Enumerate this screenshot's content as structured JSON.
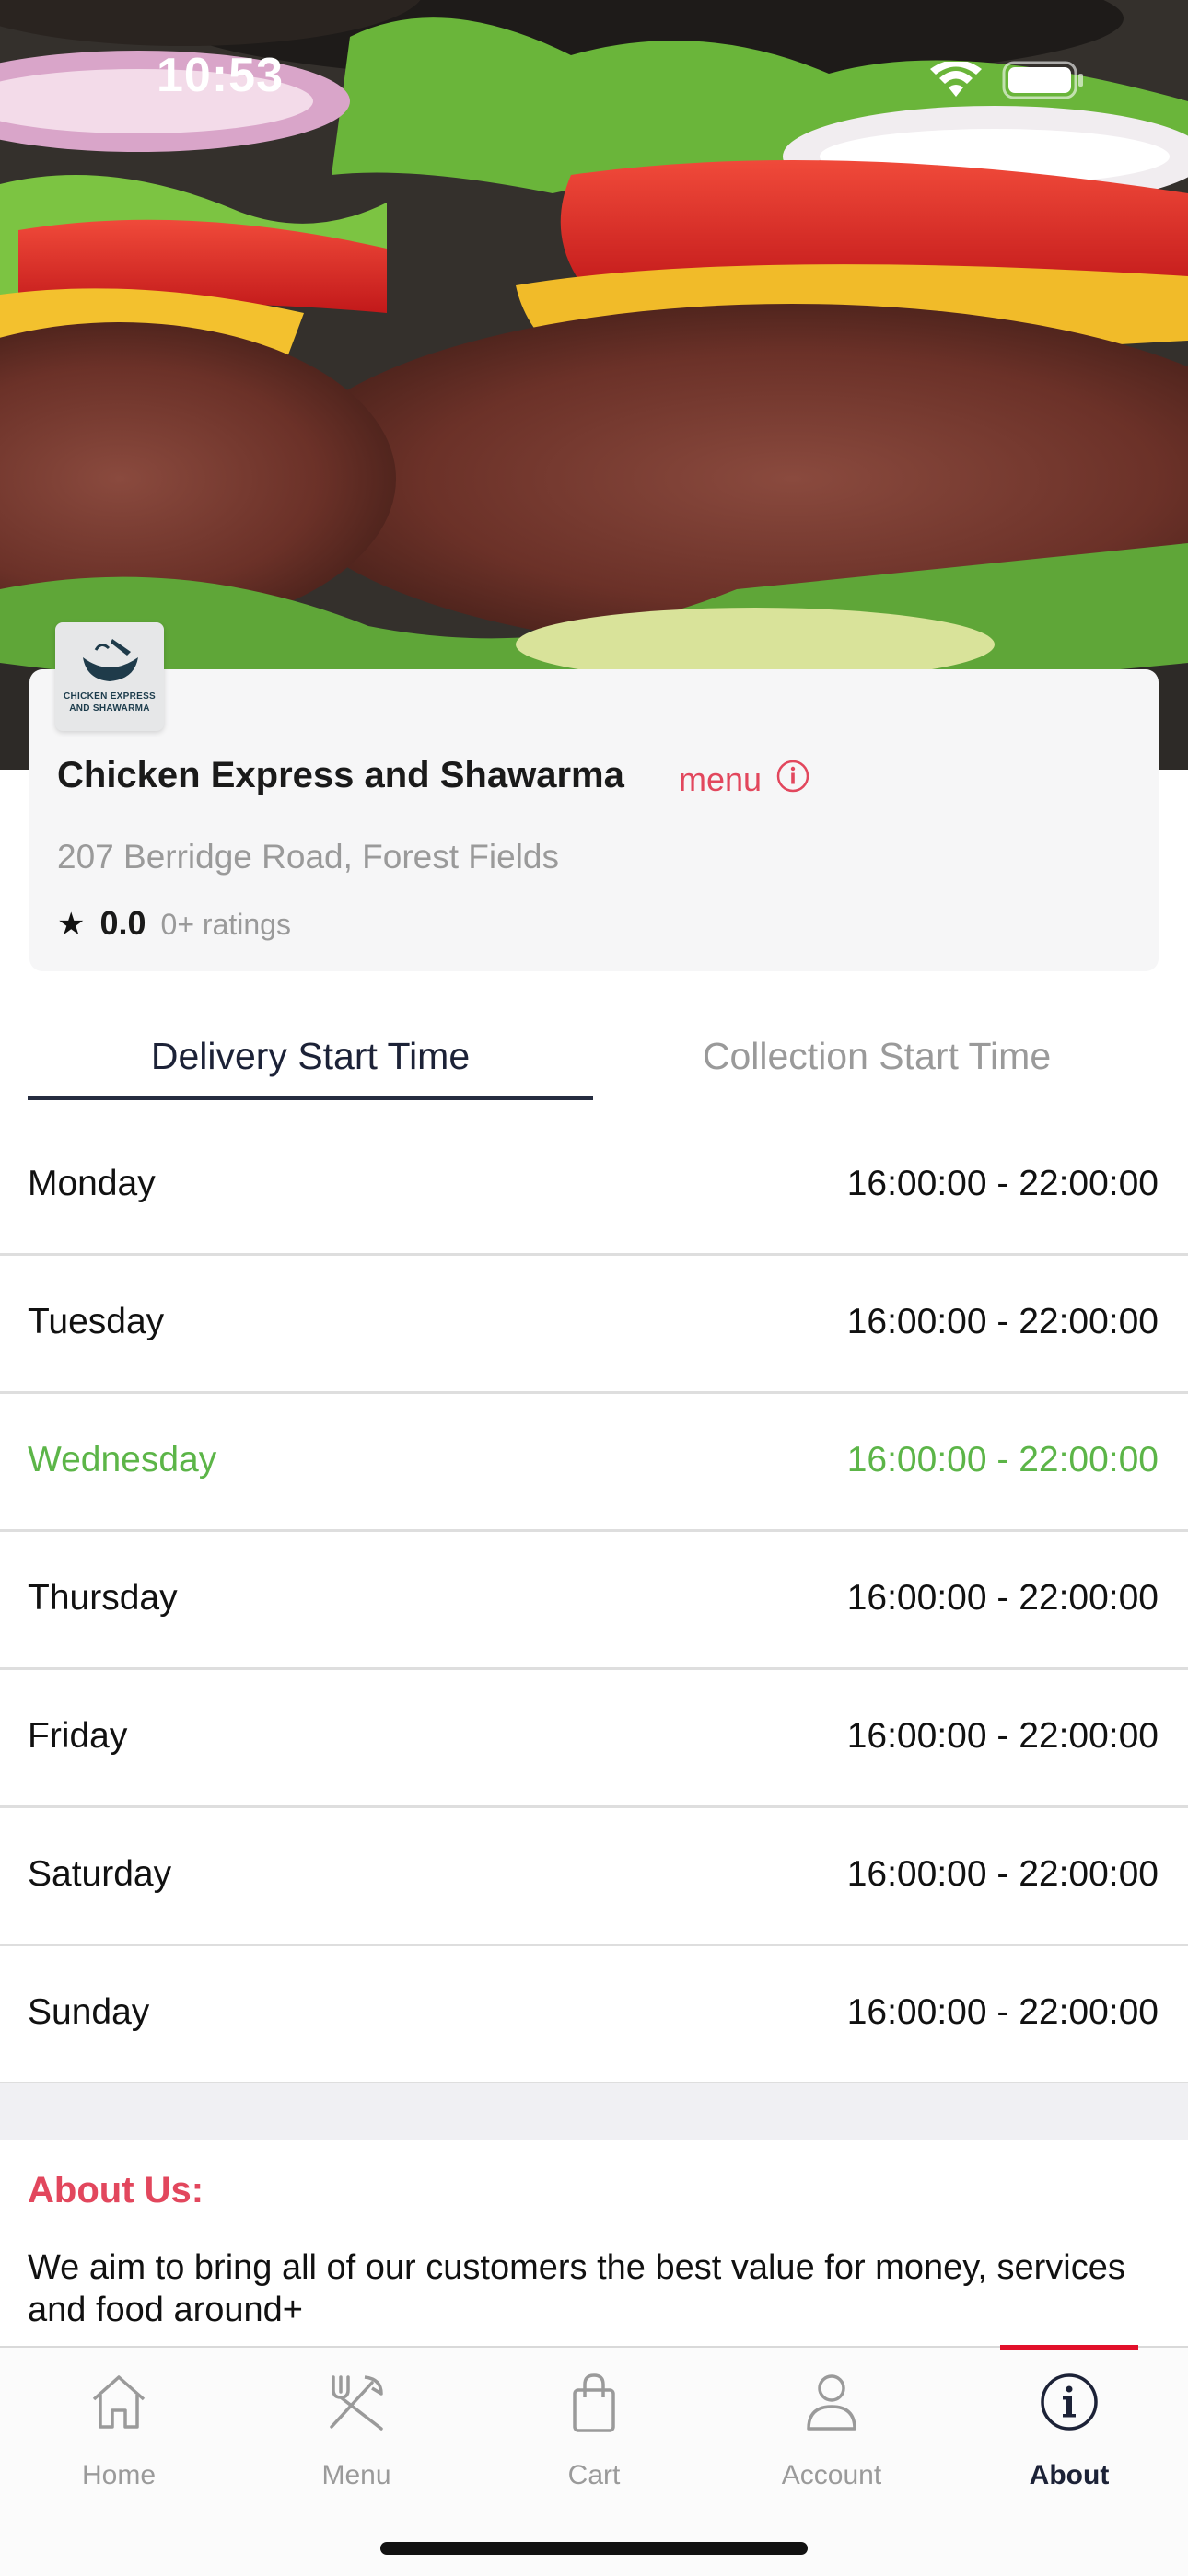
{
  "status_bar": {
    "time": "10:53"
  },
  "restaurant": {
    "logo_text": "CHICKEN EXPRESS AND SHAWARMA",
    "name": "Chicken Express and Shawarma",
    "menu_link": "menu",
    "address": "207 Berridge Road, Forest Fields",
    "rating": "0.0",
    "ratings_count": "0+ ratings"
  },
  "tabs": {
    "delivery": "Delivery Start Time",
    "collection": "Collection Start Time",
    "active": "delivery"
  },
  "hours": [
    {
      "day": "Monday",
      "time": "16:00:00 - 22:00:00"
    },
    {
      "day": "Tuesday",
      "time": "16:00:00 - 22:00:00"
    },
    {
      "day": "Wednesday",
      "time": "16:00:00 - 22:00:00",
      "today": true
    },
    {
      "day": "Thursday",
      "time": "16:00:00 - 22:00:00"
    },
    {
      "day": "Friday",
      "time": "16:00:00 - 22:00:00"
    },
    {
      "day": "Saturday",
      "time": "16:00:00 - 22:00:00"
    },
    {
      "day": "Sunday",
      "time": "16:00:00 - 22:00:00"
    }
  ],
  "about": {
    "title": "About Us:",
    "text": "We aim to bring all of our customers the best value for money, services and food around+"
  },
  "tabbar": {
    "items": [
      {
        "label": "Home",
        "icon": "home-icon"
      },
      {
        "label": "Menu",
        "icon": "fork-knife-icon"
      },
      {
        "label": "Cart",
        "icon": "shopping-bag-icon"
      },
      {
        "label": "Account",
        "icon": "person-icon"
      },
      {
        "label": "About",
        "icon": "info-icon",
        "active": true
      }
    ]
  },
  "colors": {
    "accent_red": "#e2475d",
    "today_green": "#5cb548",
    "tab_active": "#1c2237",
    "active_bar": "#e2102a"
  }
}
